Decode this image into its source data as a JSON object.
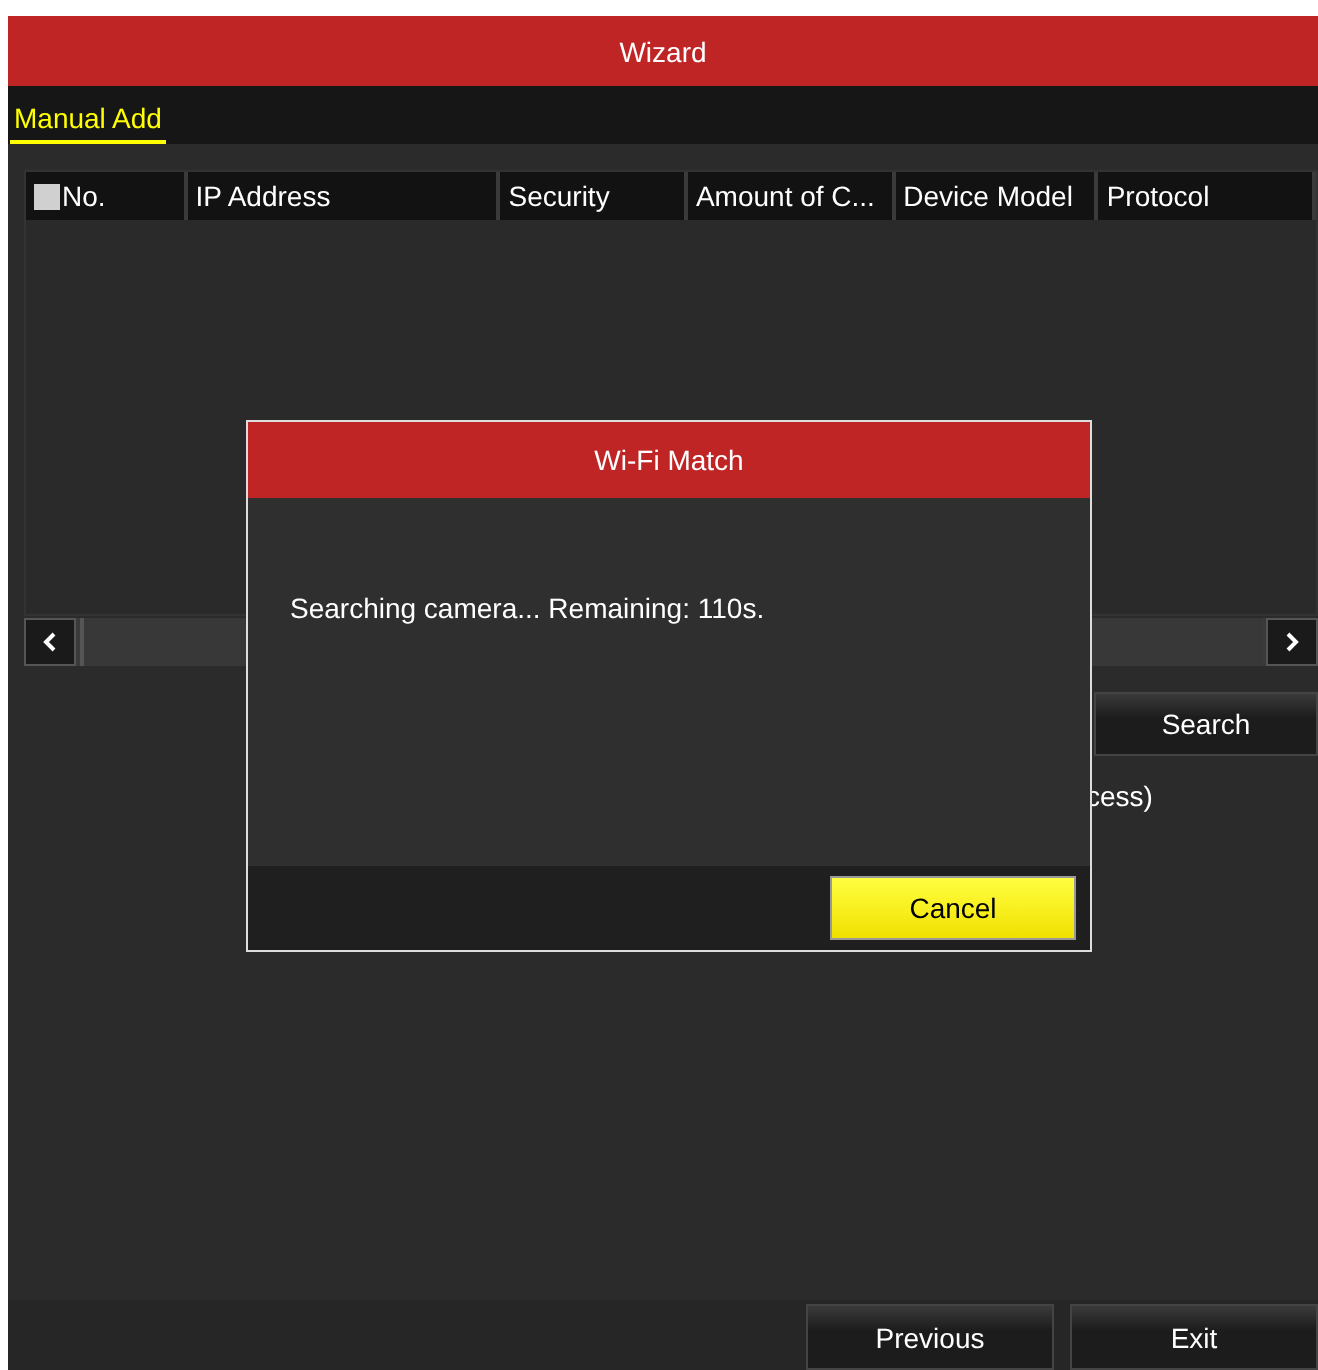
{
  "window": {
    "title": "Wizard"
  },
  "tabs": [
    {
      "label": "Manual Add",
      "selected": true
    }
  ],
  "table": {
    "select_all": {
      "checked": false
    },
    "columns": [
      "No.",
      "IP Address",
      "Security",
      "Amount of C...",
      "Device Model",
      "Protocol"
    ]
  },
  "search_button": "Search",
  "partial_text": "cess)",
  "dialog": {
    "title": "Wi-Fi Match",
    "message": "Searching camera... Remaining: 110s.",
    "buttons": [
      "Cancel"
    ]
  },
  "footer_buttons": [
    "Previous",
    "Exit"
  ]
}
